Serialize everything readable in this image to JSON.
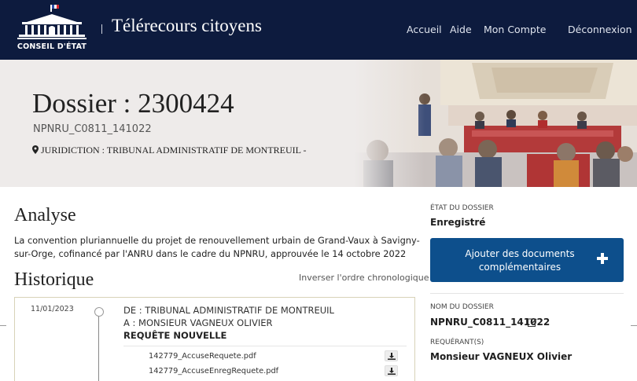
{
  "header": {
    "logo_text": "CONSEIL D'ÉTAT",
    "app_title": "Télérecours citoyens",
    "nav": [
      {
        "label": "Accueil"
      },
      {
        "label": "Aide"
      },
      {
        "label": "Mon Compte"
      },
      {
        "label": "Déconnexion"
      }
    ]
  },
  "dossier": {
    "title": "Dossier : 2300424",
    "reference": "NPNRU_C0811_141022",
    "juridiction": "JURIDICTION : TRIBUNAL ADMINISTRATIF DE MONTREUIL -"
  },
  "analyse": {
    "heading": "Analyse",
    "text": "La convention pluriannuelle du projet de renouvellement urbain de Grand-Vaux à Savigny-sur-Orge, cofinancé par l'ANRU dans le cadre du NPNRU, approuvée le 14 octobre 2022"
  },
  "historique": {
    "heading": "Historique",
    "invert_label": "Inverser l'ordre chronologique",
    "entries": [
      {
        "date": "11/01/2023",
        "from": "DE : TRIBUNAL ADMINISTRATIF DE MONTREUIL",
        "to": "A : MONSIEUR VAGNEUX OLIVIER",
        "type": "REQUÊTE NOUVELLE",
        "files": [
          {
            "name": "142779_AccuseRequete.pdf"
          },
          {
            "name": "142779_AccuseEnregRequete.pdf"
          }
        ]
      }
    ]
  },
  "sidebar": {
    "etat_label": "ÉTAT DU DOSSIER",
    "etat_value": "Enregistré",
    "add_button_label": "Ajouter des documents complémentaires",
    "nom_label": "NOM DU DOSSIER",
    "nom_value": "NPNRU_C0811_141022",
    "requerant_label": "REQUÉRANT(S)",
    "requerant_value": "Monsieur VAGNEUX Olivier"
  },
  "colors": {
    "header_bg": "#0d1b3e",
    "accent_button": "#0d4f8c",
    "banner_bg": "#eeebea"
  }
}
